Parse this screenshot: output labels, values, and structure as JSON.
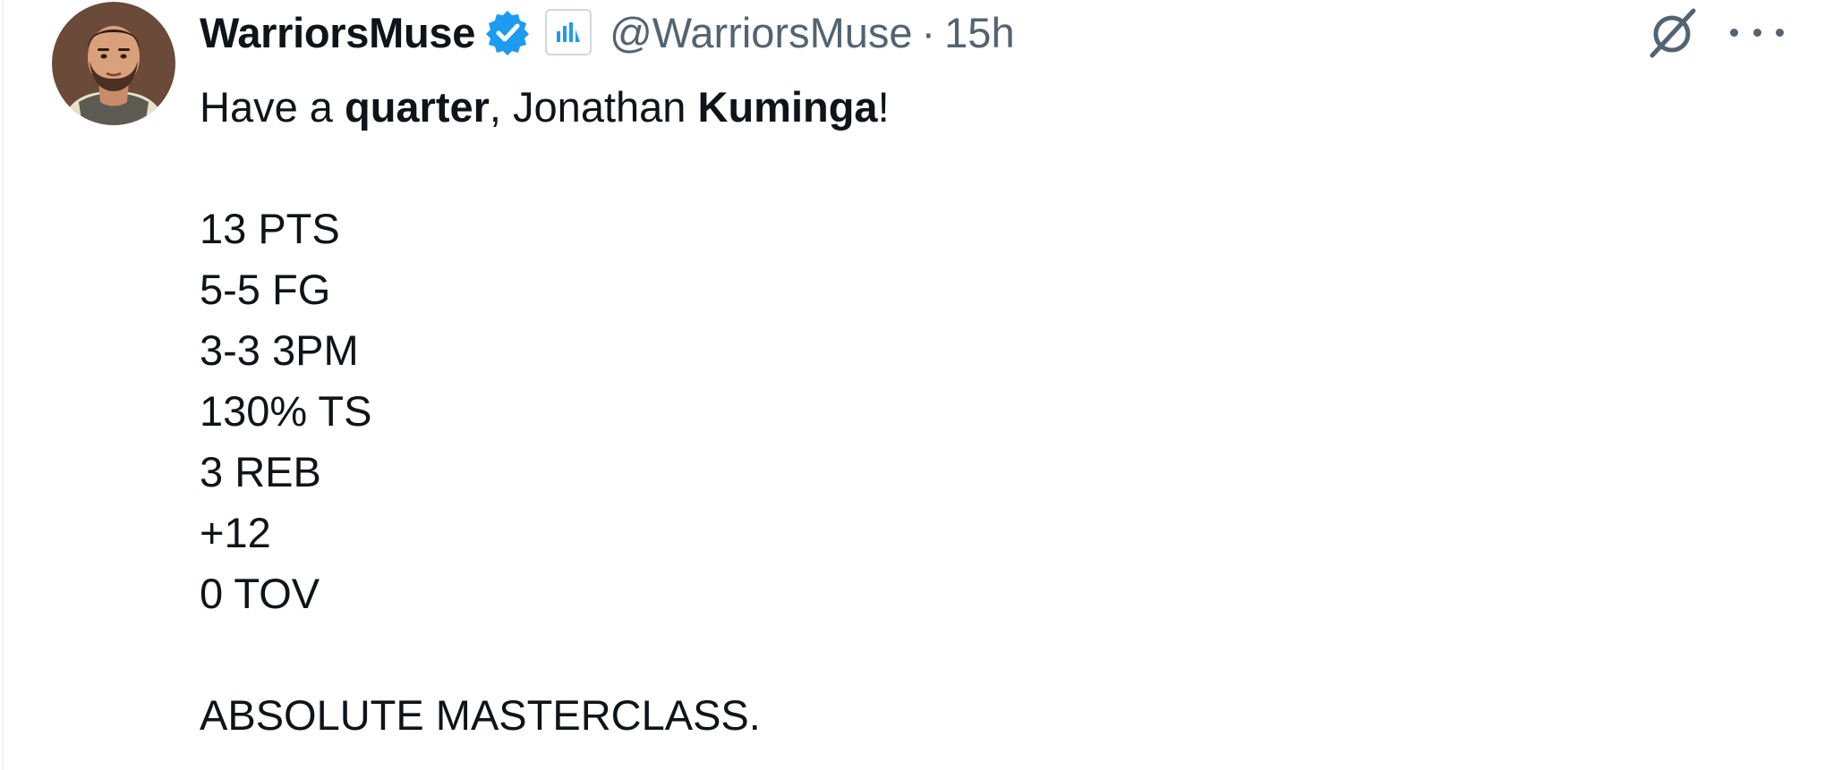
{
  "author": {
    "display_name": "WarriorsMuse",
    "handle": "@WarriorsMuse",
    "separator": "·",
    "time": "15h"
  },
  "icons": {
    "verified": "verified-badge-icon",
    "affiliate": "affiliate-badge-icon",
    "grok": "grok-icon",
    "more": "more-options-icon"
  },
  "colors": {
    "verified_blue": "#1d9bf0",
    "secondary_text": "#536471",
    "primary_text": "#0f1419"
  },
  "tweet": {
    "intro": {
      "p1": "Have a ",
      "b1": "quarter",
      "p2": ", Jonathan ",
      "b2": "Kuminga",
      "p3": "!"
    },
    "stats": [
      "13 PTS",
      "5-5 FG",
      "3-3 3PM",
      "130% TS",
      "3 REB",
      "+12",
      "0 TOV"
    ],
    "closing": "ABSOLUTE MASTERCLASS."
  }
}
